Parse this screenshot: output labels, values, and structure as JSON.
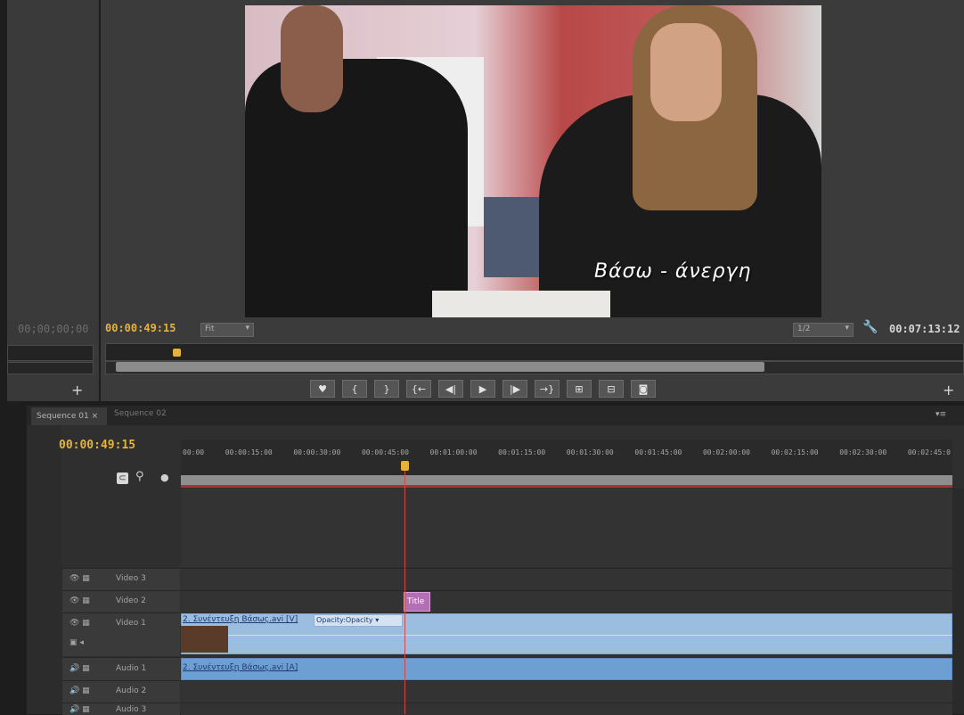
{
  "source_monitor": {
    "timecode": "00;00;00;00"
  },
  "program_monitor": {
    "timecode": "00:00:49:15",
    "fit_label": "Fit",
    "resolution_label": "1/2",
    "duration": "00:07:13:12",
    "subtitle": "Βάσω - άνεργη",
    "transport": {
      "marker": "♥",
      "mark_in": "{",
      "mark_out": "}",
      "go_in": "{←",
      "step_back": "◀|",
      "play": "▶",
      "step_fwd": "|▶",
      "go_out": "→}",
      "lift": "⊞",
      "extract": "⊟",
      "export_frame": "◙"
    }
  },
  "timeline": {
    "tabs": [
      "Sequence 01 ×",
      "Sequence 02"
    ],
    "timecode": "00:00:49:15",
    "ruler_labels": [
      "00:00",
      "00:00:15:00",
      "00:00:30:00",
      "00:00:45:00",
      "00:01:00:00",
      "00:01:15:00",
      "00:01:30:00",
      "00:01:45:00",
      "00:02:00:00",
      "00:02:15:00",
      "00:02:30:00",
      "00:02:45:0"
    ],
    "tracks": [
      {
        "name": "Video 3"
      },
      {
        "name": "Video 2"
      },
      {
        "name": "Video 1"
      },
      {
        "name": "Audio 1"
      },
      {
        "name": "Audio 2"
      },
      {
        "name": "Audio 3"
      }
    ],
    "title_clip": "Title",
    "video_clip_name": "2. Συνέντευξη Βάσως.avi [V]",
    "video_clip_effect": "Opacity:Opacity ▾",
    "audio_clip_name": "2. Συνέντευξη Βάσως.avi [A]"
  }
}
